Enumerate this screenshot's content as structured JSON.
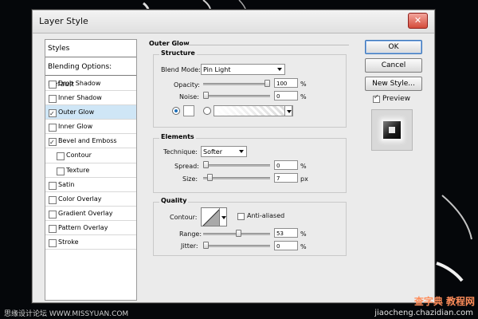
{
  "dialog": {
    "title": "Layer Style",
    "close_symbol": "✕"
  },
  "left_panel": {
    "styles_label": "Styles",
    "blending_label": "Blending Options: Default",
    "items": [
      {
        "label": "Drop Shadow",
        "checked": false,
        "selected": false,
        "indent": false
      },
      {
        "label": "Inner Shadow",
        "checked": false,
        "selected": false,
        "indent": false
      },
      {
        "label": "Outer Glow",
        "checked": true,
        "selected": true,
        "indent": false
      },
      {
        "label": "Inner Glow",
        "checked": false,
        "selected": false,
        "indent": false
      },
      {
        "label": "Bevel and Emboss",
        "checked": true,
        "selected": false,
        "indent": false
      },
      {
        "label": "Contour",
        "checked": false,
        "selected": false,
        "indent": true
      },
      {
        "label": "Texture",
        "checked": false,
        "selected": false,
        "indent": true
      },
      {
        "label": "Satin",
        "checked": false,
        "selected": false,
        "indent": false
      },
      {
        "label": "Color Overlay",
        "checked": false,
        "selected": false,
        "indent": false
      },
      {
        "label": "Gradient Overlay",
        "checked": false,
        "selected": false,
        "indent": false
      },
      {
        "label": "Pattern Overlay",
        "checked": false,
        "selected": false,
        "indent": false
      },
      {
        "label": "Stroke",
        "checked": false,
        "selected": false,
        "indent": false
      }
    ]
  },
  "outer_glow": {
    "heading": "Outer Glow",
    "structure": {
      "legend": "Structure",
      "blend_mode_label": "Blend Mode:",
      "blend_mode_value": "Pin Light",
      "opacity_label": "Opacity:",
      "opacity_value": "100",
      "opacity_unit": "%",
      "opacity_fraction": 1.0,
      "noise_label": "Noise:",
      "noise_value": "0",
      "noise_unit": "%",
      "noise_fraction": 0.0,
      "color_swatch_hex": "#ffffff"
    },
    "elements": {
      "legend": "Elements",
      "technique_label": "Technique:",
      "technique_value": "Softer",
      "spread_label": "Spread:",
      "spread_value": "0",
      "spread_unit": "%",
      "spread_fraction": 0.0,
      "size_label": "Size:",
      "size_value": "7",
      "size_unit": "px",
      "size_fraction": 0.07
    },
    "quality": {
      "legend": "Quality",
      "contour_label": "Contour:",
      "antialiased_label": "Anti-aliased",
      "antialiased_checked": false,
      "range_label": "Range:",
      "range_value": "53",
      "range_unit": "%",
      "range_fraction": 0.53,
      "jitter_label": "Jitter:",
      "jitter_value": "0",
      "jitter_unit": "%",
      "jitter_fraction": 0.0
    }
  },
  "actions": {
    "ok": "OK",
    "cancel": "Cancel",
    "new_style": "New Style...",
    "preview_label": "Preview",
    "preview_checked": true
  },
  "watermarks": {
    "left": "思缘设计论坛 WWW.MISSYUAN.COM",
    "right": "查字典 教程网",
    "url": "jiaocheng.chazidian.com"
  }
}
